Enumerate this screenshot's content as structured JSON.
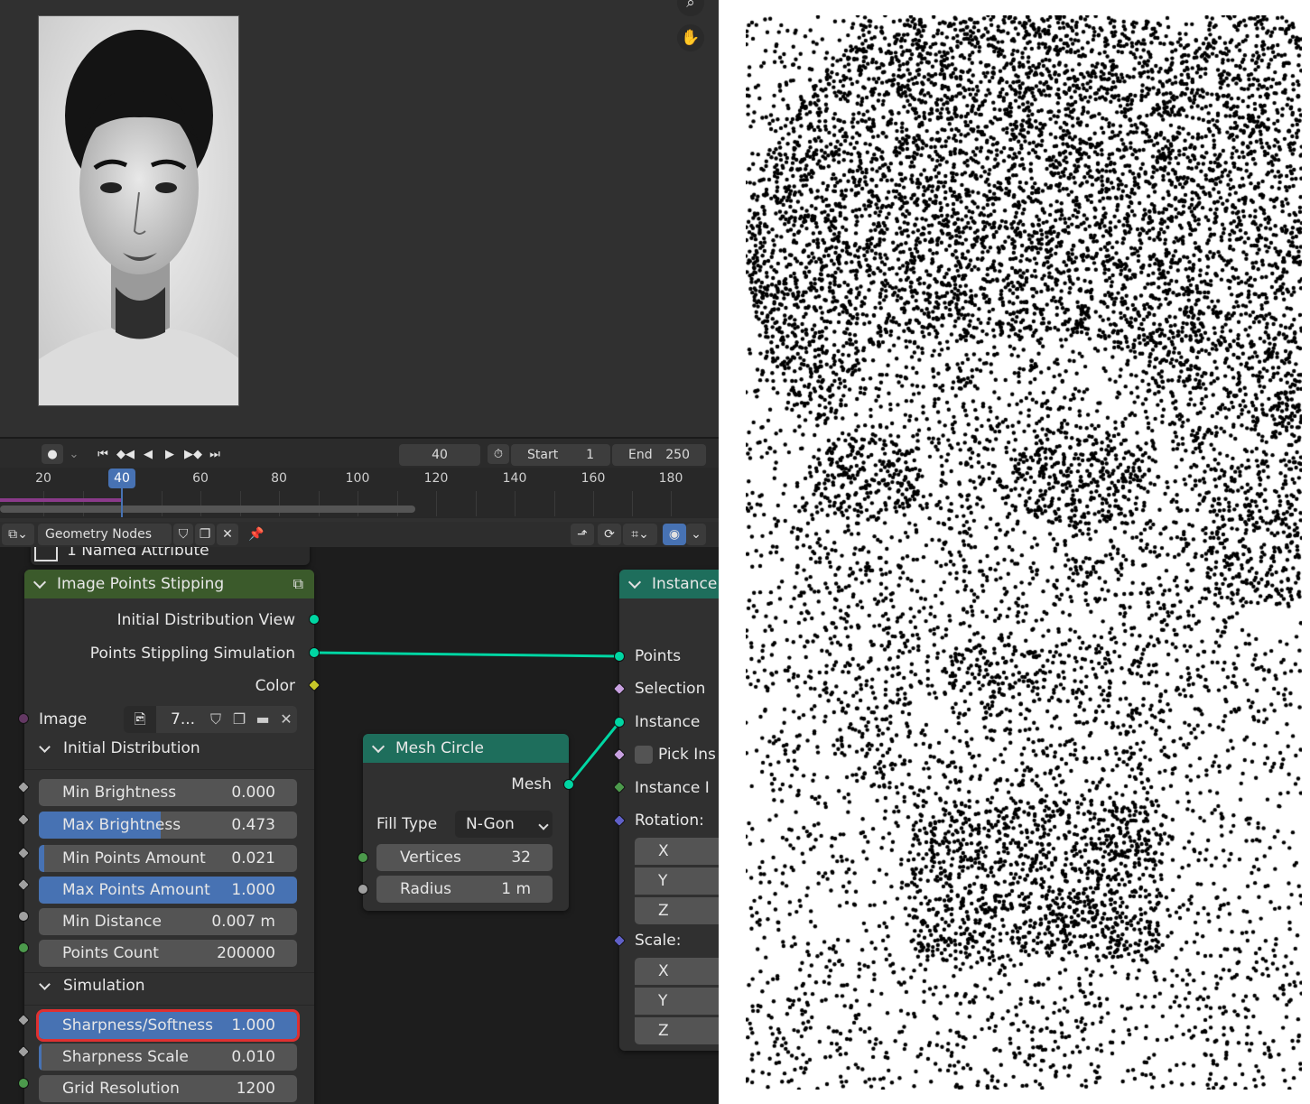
{
  "playback": {
    "current_frame": "40",
    "start_label": "Start",
    "start_value": "1",
    "end_label": "End",
    "end_value": "250"
  },
  "timeline": {
    "ticks": [
      "20",
      "40",
      "60",
      "80",
      "100",
      "120",
      "140",
      "160",
      "180"
    ],
    "marker": "40"
  },
  "node_editor": {
    "tree_name": "Geometry Nodes"
  },
  "named_attr_node": {
    "title": "1 Named Attribute"
  },
  "stipple_node": {
    "title": "Image Points Stipping",
    "outputs": [
      "Initial Distribution View",
      "Points Stippling Simulation",
      "Color"
    ],
    "image_label": "Image",
    "image_name": "7...",
    "section_initial": "Initial Distribution",
    "initial_fields": [
      {
        "label": "Min Brightness",
        "value": "0.000",
        "fill": 0.0
      },
      {
        "label": "Max Brightness",
        "value": "0.473",
        "fill": 0.473
      },
      {
        "label": "Min Points Amount",
        "value": "0.021",
        "fill": 0.021
      },
      {
        "label": "Max Points Amount",
        "value": "1.000",
        "fill": 1.0
      },
      {
        "label": "Min Distance",
        "value": "0.007 m",
        "fill": 0
      },
      {
        "label": "Points Count",
        "value": "200000",
        "fill": 0
      }
    ],
    "section_simulation": "Simulation",
    "sim_fields": [
      {
        "label": "Sharpness/Softness",
        "value": "1.000",
        "fill": 1.0
      },
      {
        "label": "Sharpness Scale",
        "value": "0.010",
        "fill": 0.01
      },
      {
        "label": "Grid Resolution",
        "value": "1200",
        "fill": 0
      }
    ]
  },
  "mesh_circle_node": {
    "title": "Mesh Circle",
    "output": "Mesh",
    "fill_type_label": "Fill Type",
    "fill_type_value": "N-Gon",
    "vertices_label": "Vertices",
    "vertices_value": "32",
    "radius_label": "Radius",
    "radius_value": "1 m"
  },
  "instance_node": {
    "title": "Instance",
    "inputs": [
      "Points",
      "Selection",
      "Instance",
      "Pick Ins",
      "Instance I",
      "Rotation:"
    ],
    "rotation_axes": [
      "X",
      "Y",
      "Z"
    ],
    "scale_label": "Scale:",
    "scale_axes": [
      "X",
      "Y",
      "Z"
    ]
  },
  "colors": {
    "geometry_socket": "#00d6a3",
    "field_socket_diamond": "#a0a0a0",
    "color_socket": "#c7c729",
    "image_socket": "#633863",
    "accent_blue": "#4772b3",
    "node_header_green": "#3b5a2b",
    "node_header_teal": "#1e6e5c",
    "highlight_red": "#e03030"
  }
}
